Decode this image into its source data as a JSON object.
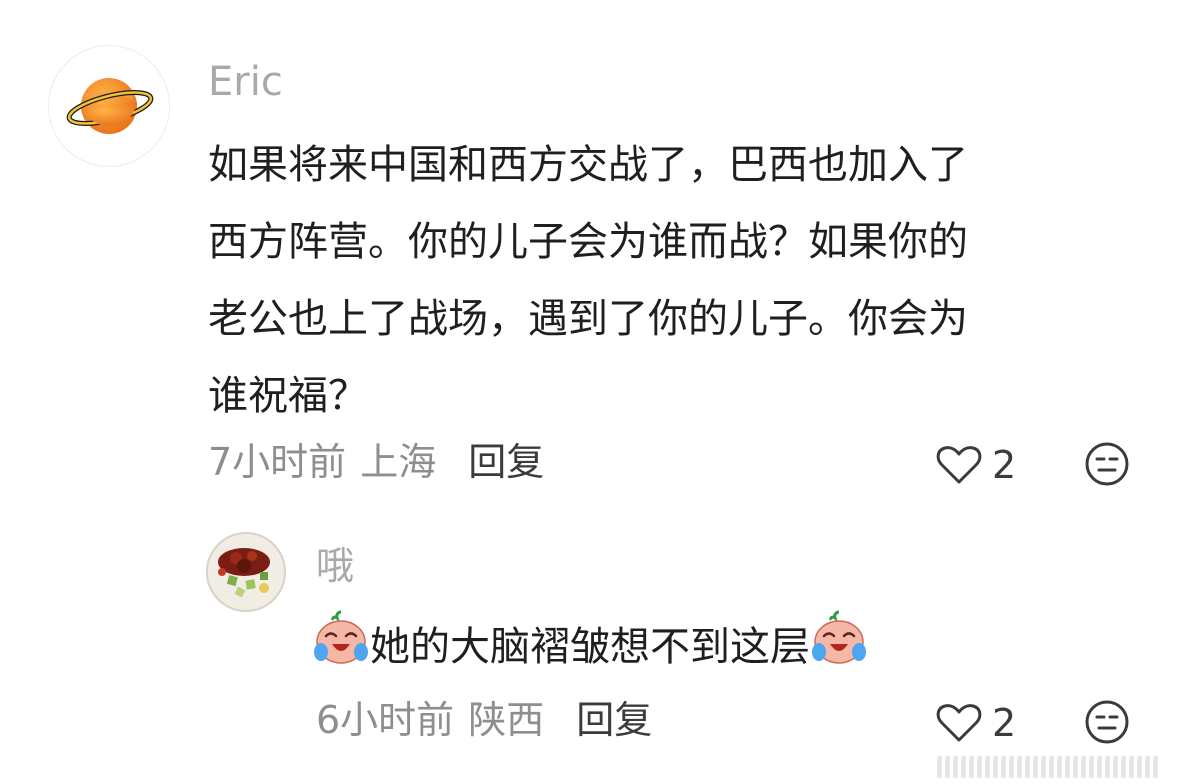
{
  "comments": [
    {
      "username": "Eric",
      "avatar_icon": "planet-icon",
      "text_lines": [
        "如果将来中国和西方交战了，巴西也加入了",
        "西方阵营。你的儿子会为谁而战？如果你的",
        "老公也上了战场，遇到了你的儿子。你会为",
        "谁祝福？"
      ],
      "time": "7小时前",
      "location": "上海",
      "reply_label": "回复",
      "likes": "2"
    },
    {
      "username": "哦",
      "avatar_icon": "food-photo-avatar",
      "text": "她的大脑褶皱想不到这层",
      "emoji_icon": "crying-laughing-emoji-icon",
      "time": "6小时前",
      "location": "陕西",
      "reply_label": "回复",
      "likes": "2"
    }
  ],
  "colors": {
    "username": "#a9a9a9",
    "text": "#1f1f1f",
    "meta": "#8e8e8e",
    "icon_stroke": "#3b3b3b",
    "planet_orange": "#f08a24",
    "planet_ring": "#f2c230"
  }
}
